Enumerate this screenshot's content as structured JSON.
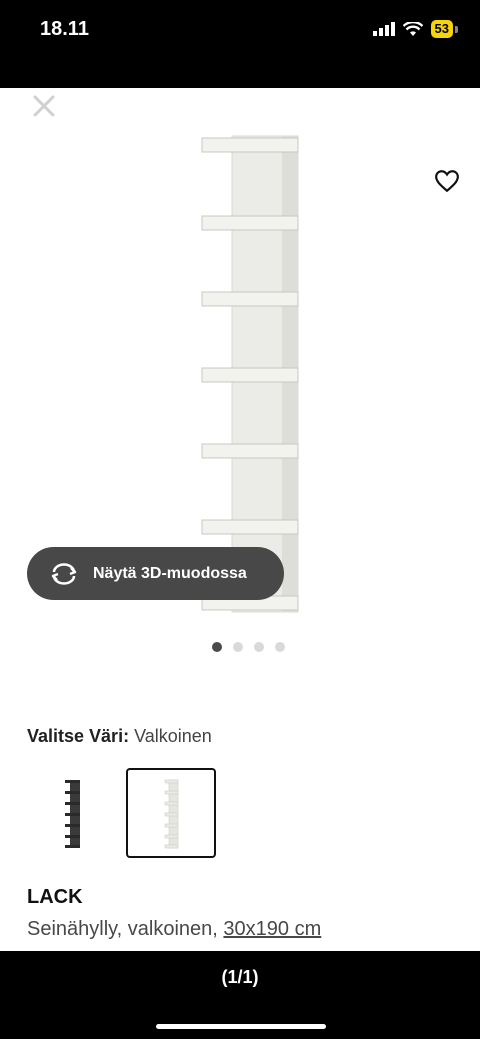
{
  "status_bar": {
    "time": "18.11",
    "battery": "53"
  },
  "view_3d": {
    "label": "Näytä 3D-muodossa"
  },
  "carousel": {
    "total": 4,
    "active": 1
  },
  "color": {
    "label": "Valitse Väri:",
    "value": "Valkoinen",
    "options": [
      "black",
      "white"
    ],
    "selected": "white"
  },
  "product": {
    "name": "LACK",
    "description": "Seinähylly, valkoinen,",
    "size": "30x190 cm"
  },
  "footer": {
    "counter": "(1/1)"
  },
  "colors": {
    "view3d_bg": "#484848",
    "dot_active": "#4a4a4a",
    "dot_inactive": "#d9d9d9",
    "battery": "#f5d50a"
  }
}
